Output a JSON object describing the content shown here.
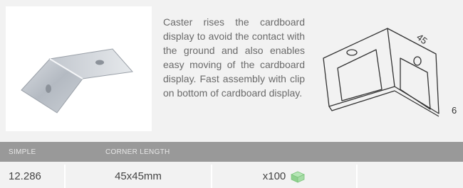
{
  "product": {
    "image_alt": "metal corner caster photo",
    "description": "Caster rises the cardboard display to avoid the contact with the ground and also enables easy moving of the cardboard display. Fast assembly with clip on bottom of cardboard display."
  },
  "diagram": {
    "dimension_top": "45",
    "dimension_side": "6"
  },
  "table": {
    "headers": [
      "SIMPLE",
      "CORNER LENGTH"
    ],
    "row": {
      "code": "12.286",
      "corner_length": "45x45mm",
      "quantity": "x100",
      "quantity_icon": "box-icon"
    }
  },
  "colors": {
    "header_bg": "#999999",
    "box_icon": "#8fd18f"
  }
}
